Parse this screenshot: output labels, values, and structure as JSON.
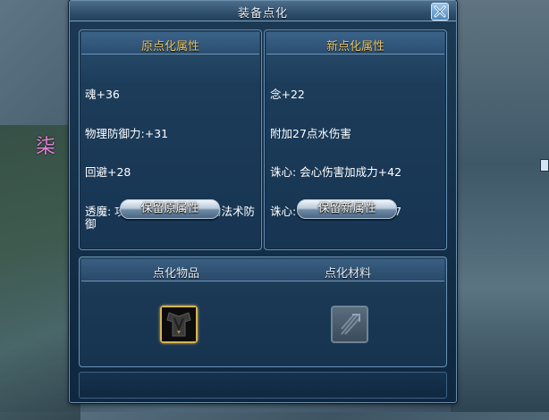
{
  "background": {
    "glyph": "柒"
  },
  "window": {
    "title": "装备点化"
  },
  "left_panel": {
    "title": "原点化属性",
    "attributes": [
      "魂+36",
      "物理防御力:+31",
      "回避+28",
      "透魔: 攻击忽视对方1.8%的法术防御"
    ],
    "button": "保留原属性"
  },
  "right_panel": {
    "title": "新点化属性",
    "attributes": [
      "念+22",
      "附加27点水伤害",
      "诛心: 会心伤害加成力+42",
      "诛心: 会心伤害加成力+47"
    ],
    "button": "保留新属性"
  },
  "bottom": {
    "item_label": "点化物品",
    "material_label": "点化材料",
    "item_icon": "equipment-icon",
    "material_icon": "material-placeholder-icon"
  },
  "colors": {
    "panel_title": "#e7c46a",
    "item_border": "#d8b455",
    "window_bg": "#14304a"
  }
}
